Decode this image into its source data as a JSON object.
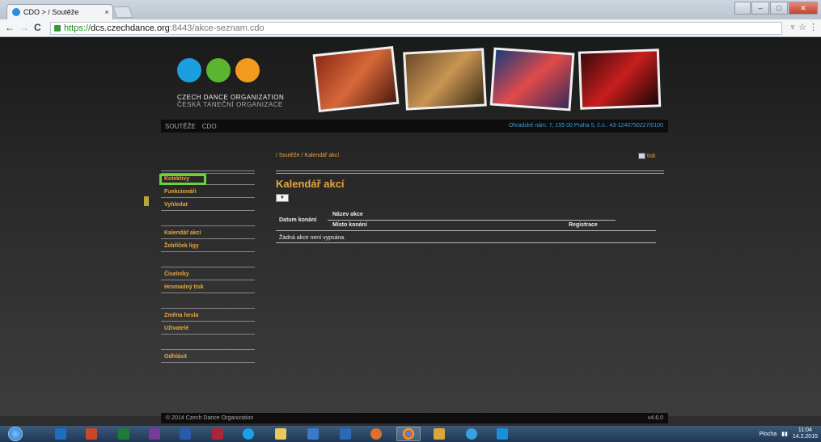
{
  "browser": {
    "tab_title": "CDO > / Soutěže",
    "tab_close": "×",
    "url_https": "https://",
    "url_host": "dcs.czechdance.org",
    "url_path": ":8443/akce-seznam.cdo",
    "back": "←",
    "forward": "→",
    "reload": "C",
    "addr_icons": "♆ ☆ ⋮",
    "min": "–",
    "max": "□",
    "close": "✕"
  },
  "site": {
    "logo_line1": "CZECH DANCE ORGANIZATION",
    "logo_line2": "ČESKÁ TANEČNÍ ORGANIZACE",
    "menu": [
      "SOUTĚŽE",
      "CDO"
    ],
    "address": "Ohradské nám. 7, 155 00 Praha 5, č.ú.: 43-1240750227/0100",
    "breadcrumb": "/ Soutěže / Kalendář akcí",
    "print": "tisk",
    "page_title": "Kalendář akcí",
    "select_value": "▼",
    "table": {
      "col_date": "Datum konání",
      "col_name": "Název akce",
      "col_place": "Místo konání",
      "col_reg": "Registrace",
      "empty": "Žádná akce není vypsána."
    },
    "sidebar": {
      "kolektivy": "Kolektivy",
      "funkcionari": "Funkcionáři",
      "vyhledat": "Vyhledat",
      "kalendar": "Kalendář akcí",
      "zebricek": "Žebříček ligy",
      "ciselniky": "Číselníky",
      "hromadny": "Hromadný tisk",
      "zmena": "Změna hesla",
      "uzivatele": "Uživatelé",
      "odhlasit": "Odhlásit"
    },
    "footer_left": "© 2014 Czech Dance Organization",
    "footer_right": "v4.6.0"
  },
  "taskbar": {
    "plocha": "Plocha",
    "time": "11:04",
    "date": "14.2.2015"
  },
  "colors": {
    "accent": "#e9a63d",
    "link_blue": "#3b9edb",
    "active_outline": "#6ed23d",
    "logo_blue": "#1a9ee0",
    "logo_green": "#5cb531",
    "logo_orange": "#f29a1f"
  }
}
